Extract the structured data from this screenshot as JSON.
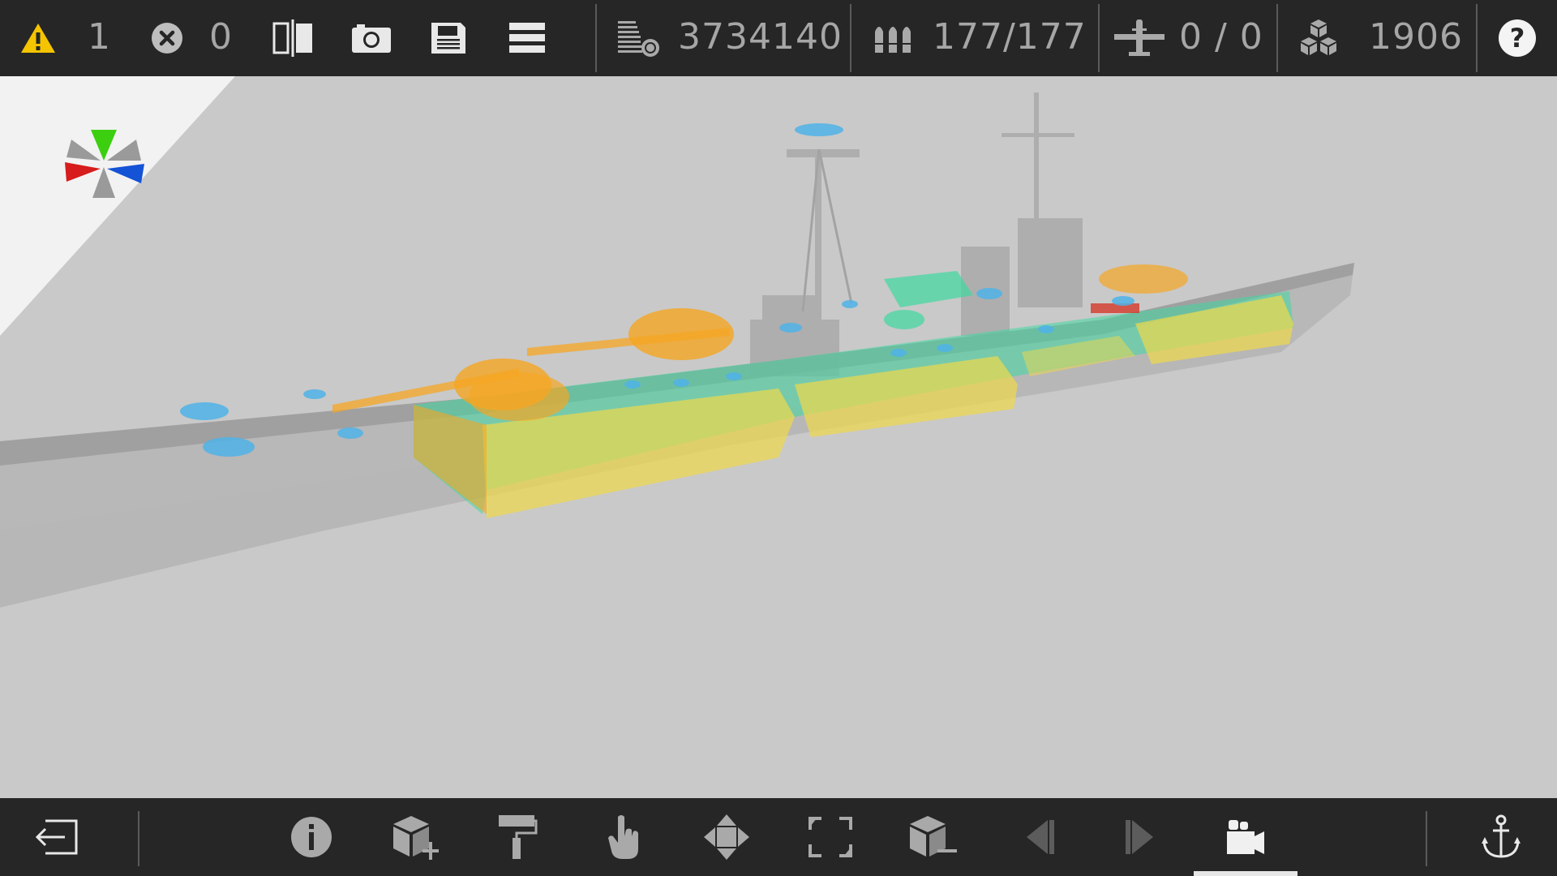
{
  "topbar": {
    "warnings_count": "1",
    "errors_count": "0",
    "cost_value": "3734140",
    "ammo_value": "177/177",
    "aircraft_value": "0 / 0",
    "parts_value": "1906",
    "help_symbol": "?"
  },
  "icons": {
    "warning": "warning-triangle-icon",
    "error": "error-circle-icon",
    "compare": "compare-panels-icon",
    "camera": "camera-icon",
    "save": "save-icon",
    "menu": "menu-icon",
    "cost": "cost-stack-icon",
    "ammo": "ammo-shells-icon",
    "aircraft": "aircraft-icon",
    "parts": "parts-cubes-icon",
    "help": "help-icon"
  },
  "colors": {
    "bar_bg": "#262626",
    "viewport_bg": "#c9c9c9",
    "warning": "#f5c400",
    "armor_yellow": "#f0d84a",
    "armor_orange": "#f5a623",
    "armor_green": "#3fd9a0",
    "turret_blue": "#4fb3e8",
    "axis_green": "#3ccf10",
    "axis_red": "#d61c1c",
    "axis_blue": "#1452d6"
  }
}
